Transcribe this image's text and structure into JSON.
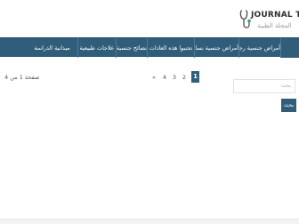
{
  "logo": {
    "title": "JOURNAL TEB",
    "subtitle": "المجلة الطبية"
  },
  "nav": {
    "items": [
      {
        "label": "أمراض جنسية رجالية"
      },
      {
        "label": "أمراض جنسية نسائية"
      },
      {
        "label": "تجنبوا هذه العادات"
      },
      {
        "label": "نصائح جنسية"
      },
      {
        "label": "علاجات طبيعية"
      },
      {
        "label": "ميدانية الدراسة"
      }
    ]
  },
  "pagination": {
    "current": "1",
    "pages": [
      "2",
      "3",
      "4"
    ],
    "next": "»",
    "info": "صفحة 1 من 4"
  },
  "search": {
    "placeholder": "بحث",
    "button_label": "بحث"
  }
}
